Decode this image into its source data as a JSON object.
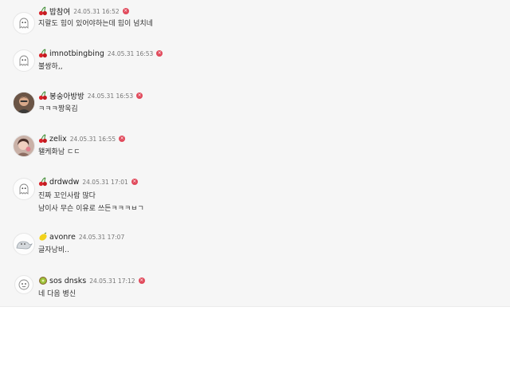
{
  "comments": [
    {
      "badge": "cherry-icon",
      "nickname": "밥참여",
      "date": "24.05.31 16:52",
      "lines": [
        "지랄도 힘이 있어야하는데 힘이 넘치네"
      ],
      "avatar": "ghost"
    },
    {
      "badge": "cherry-icon",
      "nickname": "imnotbingbing",
      "date": "24.05.31 16:53",
      "lines": [
        "불쌍하,,"
      ],
      "avatar": "ghost"
    },
    {
      "badge": "cherry-icon",
      "nickname": "봉숭아방방",
      "date": "24.05.31 16:53",
      "lines": [
        "ㅋㅋㅋ짱욱김"
      ],
      "avatar": "photo-man"
    },
    {
      "badge": "cherry-icon",
      "nickname": "zelix",
      "date": "24.05.31 16:55",
      "lines": [
        "왤케화남 ㄷㄷ"
      ],
      "avatar": "photo-woman"
    },
    {
      "badge": "cherry-icon",
      "nickname": "drdwdw",
      "date": "24.05.31 17:01",
      "lines": [
        "진짜 꼬인사람 많다",
        "남이사 무슨 이유로 쓰든ㅋㅋㅋㅂㄱ"
      ],
      "avatar": "ghost"
    },
    {
      "badge": "lemon-icon",
      "nickname": "avonre",
      "date": "24.05.31 17:07",
      "lines": [
        "글자낭비.."
      ],
      "avatar": "dino"
    },
    {
      "badge": "kiwi-icon",
      "nickname": "sos dnsks",
      "date": "24.05.31 17:12",
      "lines": [
        "네 다음 병신"
      ],
      "avatar": "face"
    }
  ],
  "delete_symbol": "×",
  "colors": {
    "panel": "#f6f6f6",
    "nickname": "#222222",
    "date": "#777777",
    "delete": "#e14a5c"
  }
}
